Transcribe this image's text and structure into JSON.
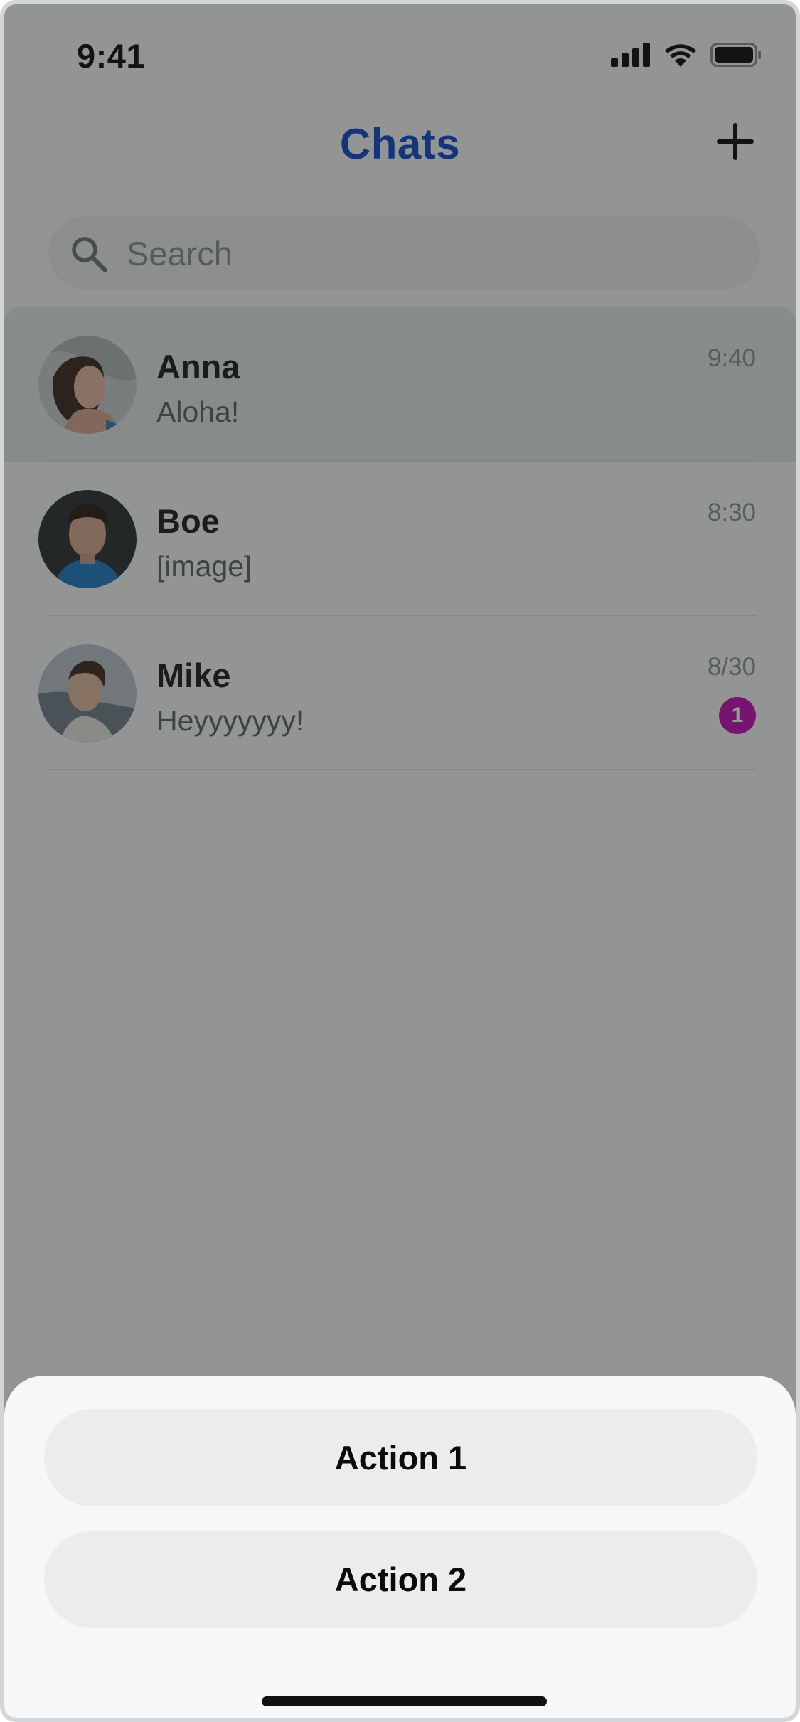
{
  "status_bar": {
    "time": "9:41",
    "icons": [
      "signal-icon",
      "wifi-icon",
      "battery-icon"
    ]
  },
  "header": {
    "title": "Chats",
    "add_icon": "plus-icon"
  },
  "search": {
    "placeholder": "Search",
    "value": "",
    "icon": "search-icon"
  },
  "chats": [
    {
      "name": "Anna",
      "preview": "Aloha!",
      "time": "9:40",
      "unread": null,
      "selected": true
    },
    {
      "name": "Boe",
      "preview": "[image]",
      "time": "8:30",
      "unread": null,
      "selected": false
    },
    {
      "name": "Mike",
      "preview": "Heyyyyyyy!",
      "time": "8/30",
      "unread": "1",
      "selected": false
    }
  ],
  "action_sheet": {
    "actions": [
      {
        "label": "Action 1"
      },
      {
        "label": "Action 2"
      }
    ]
  },
  "colors": {
    "title_blue": "#0f46c9",
    "badge_magenta": "#c00cb3",
    "overlay": "#1c201e"
  }
}
